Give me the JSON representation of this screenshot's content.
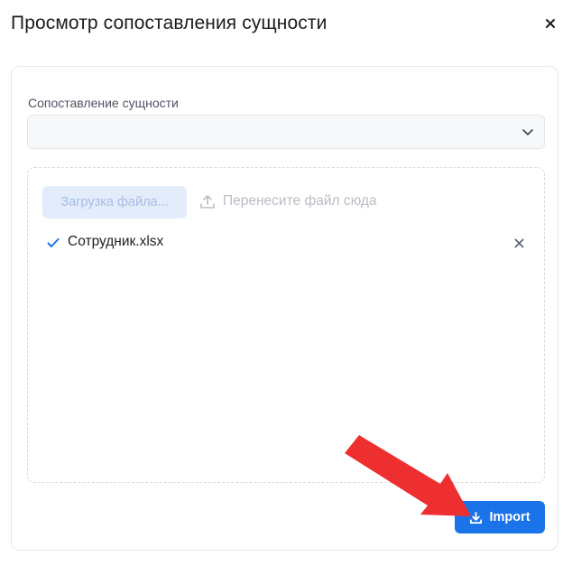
{
  "dialog": {
    "title": "Просмотр сопоставления сущности",
    "close_icon": "close-icon"
  },
  "form": {
    "entity_mapping_label": "Сопоставление сущности",
    "entity_mapping_value": "",
    "select_icon": "chevron-down-icon"
  },
  "upload": {
    "upload_button_label": "Загрузка файла...",
    "drop_hint": "Перенесите файл сюда",
    "drop_icon": "upload-icon",
    "files": [
      {
        "name": "Сотрудник.xlsx",
        "status_icon": "check-icon",
        "remove_icon": "close-icon"
      }
    ]
  },
  "footer": {
    "import_label": "Import",
    "import_icon": "download-icon"
  },
  "annotation": {
    "arrow_color": "#ee2f2f"
  },
  "colors": {
    "primary": "#1a73e8",
    "upload_button_bg": "#e2ecfb",
    "upload_button_text": "#a5bde3",
    "hint_text": "#b9bdc5",
    "check": "#1a73e8"
  }
}
